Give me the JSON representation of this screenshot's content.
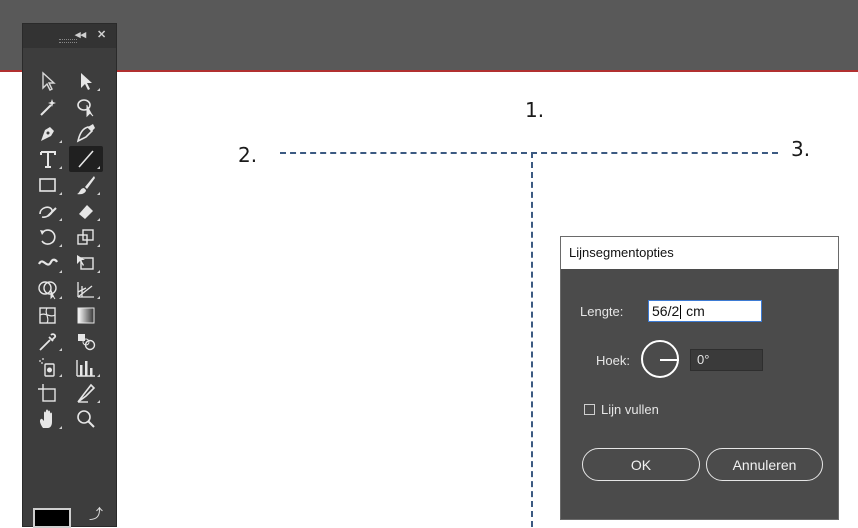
{
  "canvas": {
    "labels": {
      "one": "1.",
      "two": "2.",
      "three": "3."
    }
  },
  "toolbox": {
    "collapse_glyph": "◂◂",
    "close_glyph": "✕",
    "tools": [
      {
        "name": "selection-tool-icon"
      },
      {
        "name": "direct-selection-tool-icon"
      },
      {
        "name": "magic-wand-tool-icon"
      },
      {
        "name": "lasso-tool-icon"
      },
      {
        "name": "pen-tool-icon"
      },
      {
        "name": "curvature-tool-icon"
      },
      {
        "name": "type-tool-icon"
      },
      {
        "name": "line-segment-tool-icon"
      },
      {
        "name": "rectangle-tool-icon"
      },
      {
        "name": "paintbrush-tool-icon"
      },
      {
        "name": "shaper-tool-icon"
      },
      {
        "name": "eraser-tool-icon"
      },
      {
        "name": "rotate-tool-icon"
      },
      {
        "name": "scale-tool-icon"
      },
      {
        "name": "width-tool-icon"
      },
      {
        "name": "free-transform-tool-icon"
      },
      {
        "name": "shape-builder-tool-icon"
      },
      {
        "name": "perspective-grid-tool-icon"
      },
      {
        "name": "mesh-tool-icon"
      },
      {
        "name": "gradient-tool-icon"
      },
      {
        "name": "eyedropper-tool-icon"
      },
      {
        "name": "blend-tool-icon"
      },
      {
        "name": "symbol-sprayer-tool-icon"
      },
      {
        "name": "column-graph-tool-icon"
      },
      {
        "name": "artboard-tool-icon"
      },
      {
        "name": "slice-tool-icon"
      },
      {
        "name": "hand-tool-icon"
      },
      {
        "name": "zoom-tool-icon"
      }
    ],
    "active_tool": "line-segment-tool-icon",
    "fill_color": "#000000",
    "swap_glyph": "⤴"
  },
  "dialog": {
    "title": "Lijnsegmentopties",
    "length_label": "Lengte:",
    "length_value_before_caret": "56/2",
    "length_value_after_caret": " cm",
    "angle_label": "Hoek:",
    "angle_value": "0°",
    "fill_line_label": "Lijn vullen",
    "fill_line_checked": false,
    "ok_label": "OK",
    "cancel_label": "Annuleren"
  },
  "colors": {
    "topbar": "#595959",
    "topbar_accent": "#b13030",
    "guide": "#3c5a82",
    "dialog_bg": "#4b4b4b",
    "focus": "#3d7bd4"
  }
}
